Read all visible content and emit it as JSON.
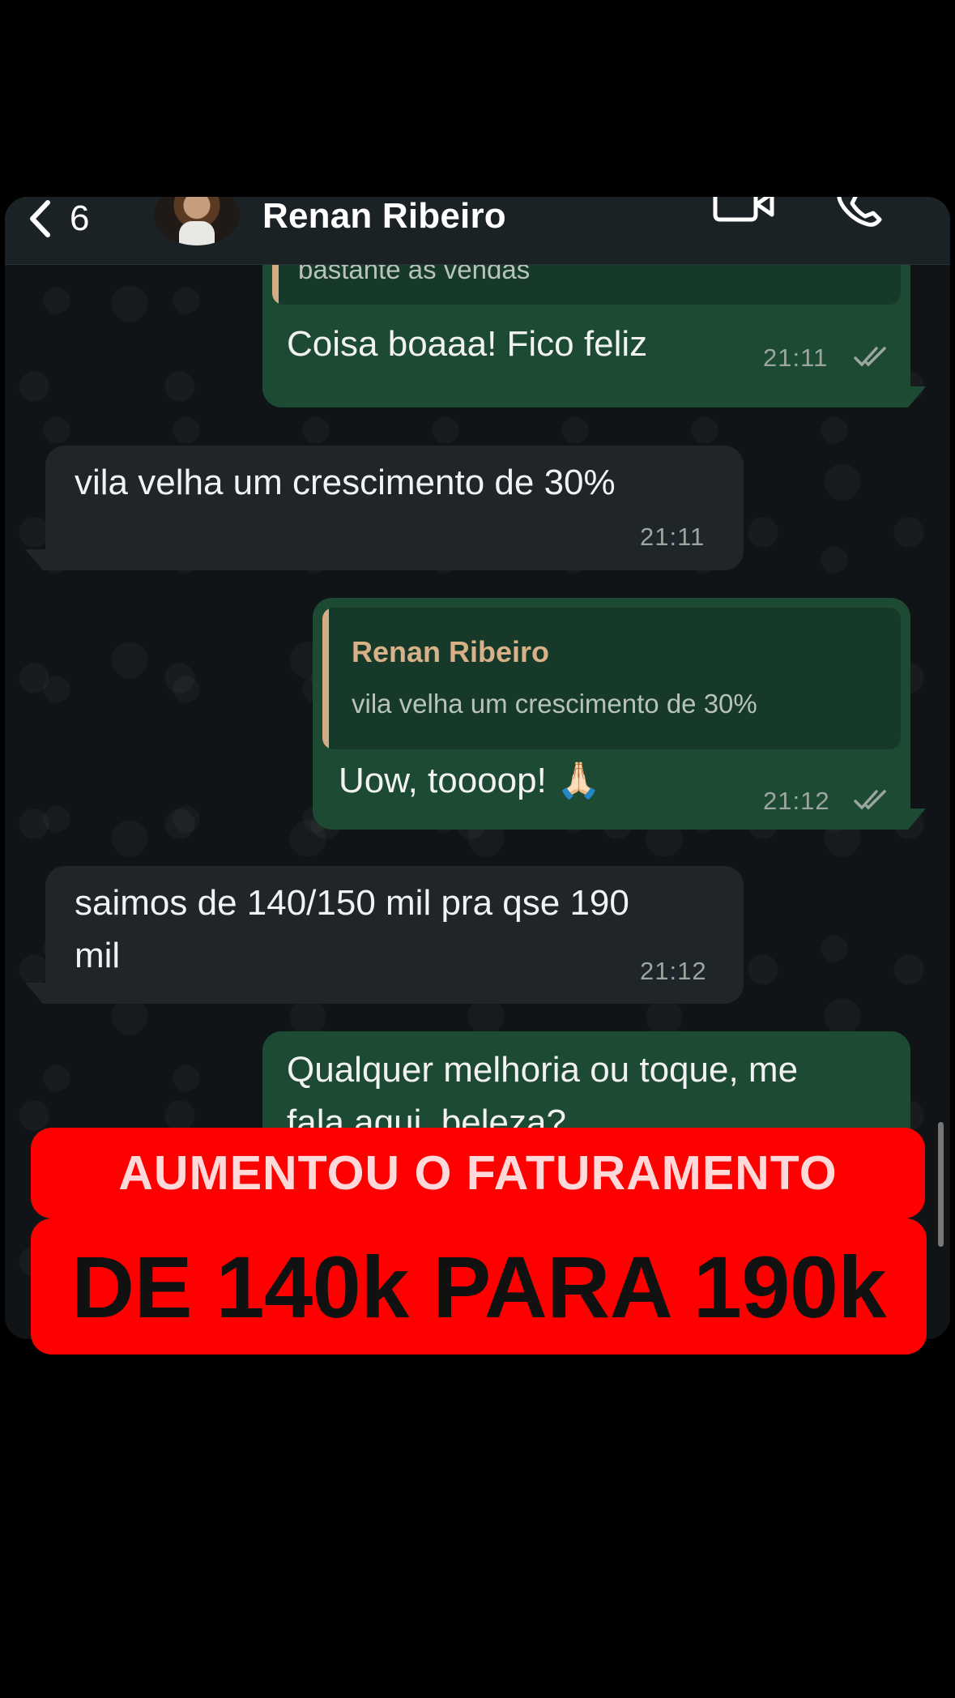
{
  "header": {
    "back_count": "6",
    "contact_name": "Renan Ribeiro"
  },
  "messages": [
    {
      "direction": "outgoing",
      "quote_text": "bastante as vendas",
      "text": "Coisa boaaa! Fico feliz",
      "time": "21:11",
      "status": "read"
    },
    {
      "direction": "incoming",
      "text": "vila velha um crescimento de 30%",
      "time": "21:11"
    },
    {
      "direction": "outgoing",
      "quote_name": "Renan Ribeiro",
      "quote_text": "vila velha um crescimento de 30%",
      "text": "Uow, toooop! 🙏🏻",
      "time": "21:12",
      "status": "read"
    },
    {
      "direction": "incoming",
      "text_line1": "saimos de 140/150 mil pra qse 190",
      "text_line2": "mil",
      "time": "21:12"
    },
    {
      "direction": "outgoing",
      "text_line1": "Qualquer melhoria ou toque, me",
      "text_line2": "fala aqui, beleza?",
      "status": "read"
    }
  ],
  "overlay": {
    "line1": "AUMENTOU O FATURAMENTO",
    "line2": "DE 140k PARA 190k"
  },
  "colors": {
    "background": "#000000",
    "chat_background": "#101417",
    "outgoing_bubble": "#1d4a32",
    "incoming_bubble": "#1f2529",
    "quote_name": "#d9b188",
    "banner": "#ff0000"
  }
}
